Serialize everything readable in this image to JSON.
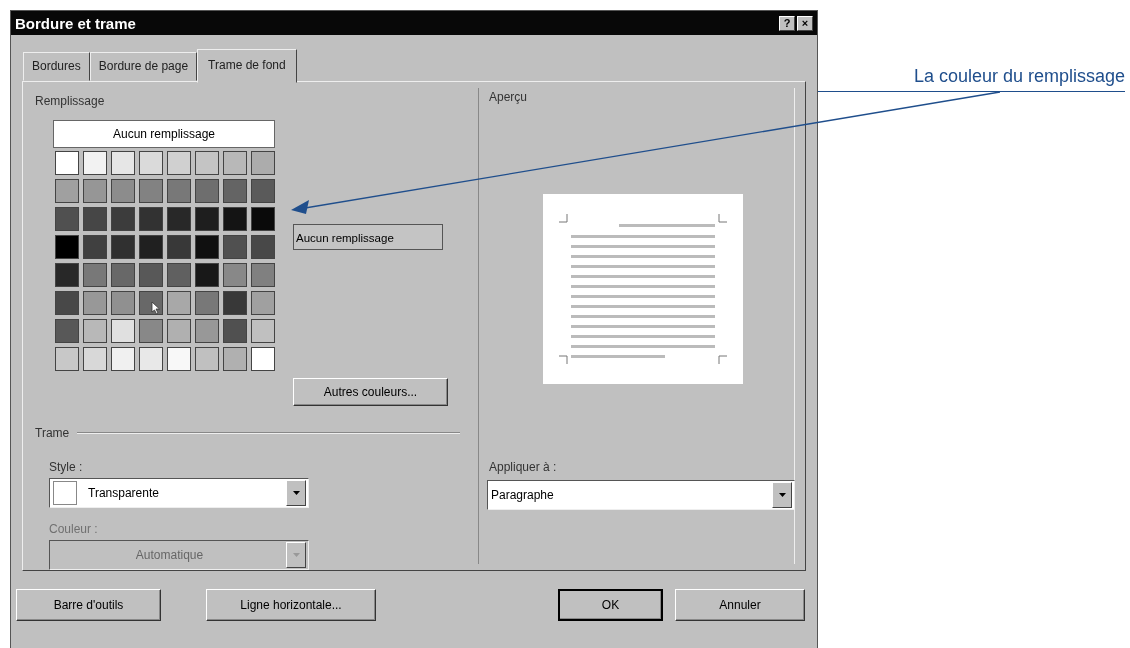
{
  "window": {
    "title": "Bordure et trame",
    "title_buttons": [
      "?",
      "×"
    ]
  },
  "tabs": [
    {
      "label": "Bordures",
      "selected": false
    },
    {
      "label": "Bordure de page",
      "selected": false
    },
    {
      "label": "Trame de fond",
      "selected": true
    }
  ],
  "fill": {
    "label": "Remplissage",
    "none_button": "Aucun remplissage",
    "current": "Aucun remplissage",
    "more_button": "Autres couleurs...",
    "swatches": [
      [
        {
          "color": "#ffffff"
        },
        {
          "color": "#f2f2f2"
        },
        {
          "color": "#e6e6e6"
        },
        {
          "color": "#dadada"
        },
        {
          "color": "#d0d0d0"
        },
        {
          "color": "#c4c4c4"
        },
        {
          "color": "#b8b8b8"
        },
        {
          "color": "#acacac"
        }
      ],
      [
        {
          "color": "#a0a0a0"
        },
        {
          "color": "#969696"
        },
        {
          "color": "#8c8c8c"
        },
        {
          "color": "#828282"
        },
        {
          "color": "#787878"
        },
        {
          "color": "#6e6e6e"
        },
        {
          "color": "#646464"
        },
        {
          "color": "#5a5a5a"
        }
      ],
      [
        {
          "color": "#505050"
        },
        {
          "color": "#464646"
        },
        {
          "color": "#3c3c3c"
        },
        {
          "color": "#323232"
        },
        {
          "color": "#282828"
        },
        {
          "color": "#1e1e1e"
        },
        {
          "color": "#141414"
        },
        {
          "color": "#0a0a0a"
        }
      ],
      [
        {
          "color": "#000000"
        },
        {
          "color": "#404040"
        },
        {
          "color": "#303030"
        },
        {
          "color": "#202020"
        },
        {
          "color": "#383838"
        },
        {
          "color": "#101010"
        },
        {
          "color": "#505050"
        },
        {
          "color": "#484848"
        }
      ],
      [
        {
          "color": "#282828"
        },
        {
          "color": "#787878"
        },
        {
          "color": "#686868"
        },
        {
          "color": "#585858"
        },
        {
          "color": "#606060"
        },
        {
          "color": "#181818"
        },
        {
          "color": "#888888"
        },
        {
          "color": "#808080"
        }
      ],
      [
        {
          "color": "#484848"
        },
        {
          "color": "#989898"
        },
        {
          "color": "#909090"
        },
        {
          "color": "#686868"
        },
        {
          "color": "#a8a8a8"
        },
        {
          "color": "#787878"
        },
        {
          "color": "#383838"
        },
        {
          "color": "#a0a0a0"
        }
      ],
      [
        {
          "color": "#585858"
        },
        {
          "color": "#b8b8b8"
        },
        {
          "color": "#e0e0e0"
        },
        {
          "color": "#888888"
        },
        {
          "color": "#b0b0b0"
        },
        {
          "color": "#989898"
        },
        {
          "color": "#505050"
        },
        {
          "color": "#c0c0c0"
        }
      ],
      [
        {
          "color": "#c8c8c8"
        },
        {
          "color": "#d8d8d8"
        },
        {
          "color": "#f0f0f0"
        },
        {
          "color": "#e8e8e8"
        },
        {
          "color": "#f8f8f8"
        },
        {
          "color": "#c0c0c0"
        },
        {
          "color": "#b0b0b0"
        },
        {
          "color": "#ffffff"
        }
      ]
    ]
  },
  "pattern": {
    "label": "Trame",
    "style_label": "Style :",
    "style_value": "Transparente",
    "color_label": "Couleur :",
    "color_value": "Automatique",
    "color_disabled": true
  },
  "preview": {
    "label": "Aperçu",
    "apply_label": "Appliquer à :",
    "apply_value": "Paragraphe"
  },
  "buttons": [
    {
      "label": "Barre d'outils",
      "default": false
    },
    {
      "label": "Ligne horizontale...",
      "default": false
    },
    {
      "label": "OK",
      "default": true
    },
    {
      "label": "Annuler",
      "default": false
    }
  ],
  "callout": {
    "text": "La couleur du remplissage"
  }
}
